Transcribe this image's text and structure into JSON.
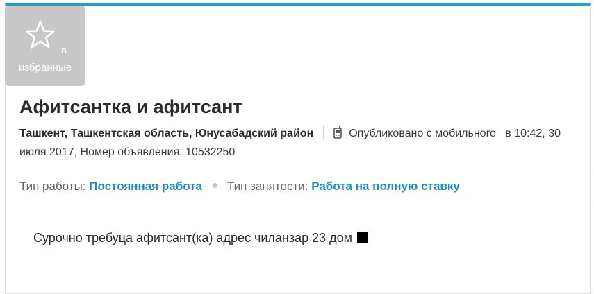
{
  "favorite": {
    "word1": "в",
    "word2": "избранные"
  },
  "listing": {
    "title": "Афитсантка и афитсант",
    "location": "Ташкент, Ташкентская область, Юнусабадский район",
    "published_from": "Опубликовано с мобильного",
    "published_at": "в 10:42, 30 июля 2017,",
    "ad_number_label": "Номер объявления:",
    "ad_number": "10532250"
  },
  "params": {
    "work_type_label": "Тип работы:",
    "work_type_value": "Постоянная работа",
    "employment_label": "Тип занятости:",
    "employment_value": "Работа на полную ставку"
  },
  "description": {
    "text": "Сурочно требуца афитсант(ка) адрес чиланзар 23 дом"
  },
  "colors": {
    "accent_top_bar": "#2a9bc5",
    "link": "#1b8dbb",
    "favorite_bg": "#c8c8c8"
  },
  "icons": {
    "favorite": "star-outline-icon",
    "mobile": "mobile-phone-icon"
  }
}
